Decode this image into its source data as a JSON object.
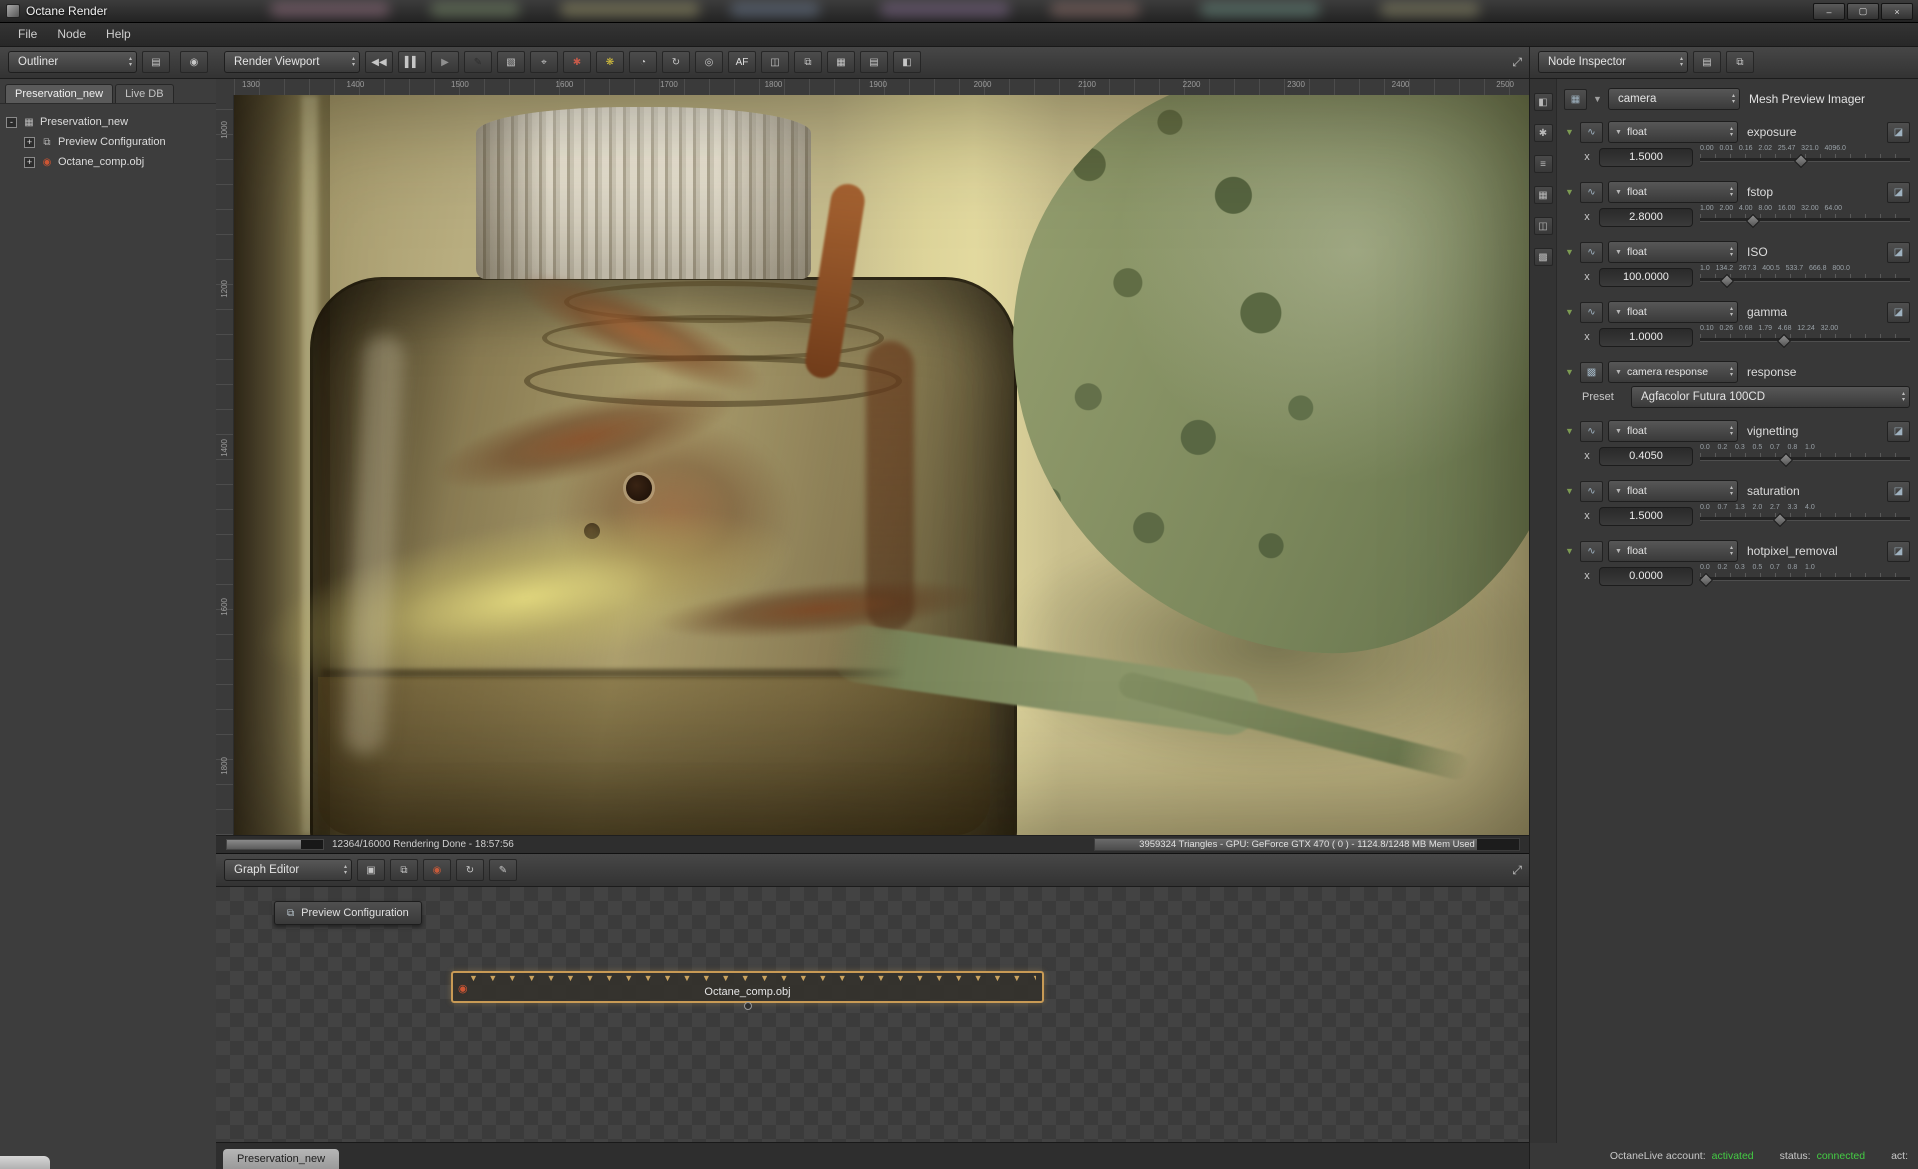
{
  "ui": {
    "dd_arrow": "▼",
    "up": "▴",
    "down": "▾",
    "tri": "▼",
    "expand": "⤢",
    "curve": "∿",
    "ramp": "◪",
    "pic": "▦",
    "resp": "▩"
  },
  "window": {
    "title": "Octane Render",
    "minimize": "–",
    "maximize": "▢",
    "close": "×"
  },
  "menu": {
    "file": "File",
    "node": "Node",
    "help": "Help"
  },
  "outliner": {
    "title": "Outliner",
    "icons": [
      {
        "g": "▤"
      },
      {
        "g": "◉"
      }
    ],
    "tabs": {
      "active": "Preservation_new",
      "other": "Live DB"
    },
    "tree": [
      {
        "toggle": "-",
        "icon": "▦",
        "label": "Preservation_new"
      },
      {
        "toggle": "+",
        "icon": "⧉",
        "label": "Preview Configuration"
      },
      {
        "toggle": "+",
        "icon": "◉",
        "label": "Octane_comp.obj"
      }
    ]
  },
  "viewport": {
    "title": "Render Viewport",
    "toolbar": [
      {
        "g": "◀◀",
        "c": "#c6c6c6"
      },
      {
        "g": "▌▌",
        "c": "#c6c6c6"
      },
      {
        "g": "▶",
        "c": "#8f8f8f"
      },
      {
        "g": "✎",
        "c": "#2e2e2e"
      },
      {
        "g": "▧",
        "c": "#c6c6c6"
      },
      {
        "g": "⌖",
        "c": "#c6c6c6"
      },
      {
        "g": "✱",
        "c": "#c65a4a"
      },
      {
        "g": "❋",
        "c": "#d9c33c"
      },
      {
        "g": "◔",
        "c": "#c6c6c6"
      },
      {
        "g": "↻",
        "c": "#c6c6c6"
      },
      {
        "g": "◎",
        "c": "#c6c6c6"
      },
      {
        "g": "AF",
        "c": "#e0e0e0"
      },
      {
        "g": "◫",
        "c": "#c6c6c6"
      },
      {
        "g": "⧉",
        "c": "#c6c6c6"
      },
      {
        "g": "▦",
        "c": "#c6c6c6"
      },
      {
        "g": "▤",
        "c": "#c6c6c6"
      },
      {
        "g": "◧",
        "c": "#c6c6c6"
      }
    ],
    "ruler_top": [
      "1300",
      "1400",
      "1500",
      "1600",
      "1700",
      "1800",
      "1900",
      "2000",
      "2100",
      "2200",
      "2300",
      "2400",
      "2500"
    ],
    "ruler_left": [
      "1000",
      "1200",
      "1400",
      "1600",
      "1800"
    ],
    "status": {
      "progress_pct": "77%",
      "progress_text": "12364/16000 Rendering Done - 18:57:56",
      "mem_pct": "90%",
      "gpu_text": "3959324 Triangles - GPU: GeForce GTX 470 ( 0 ) - 1124.8/1248 MB Mem Used"
    }
  },
  "graph": {
    "title": "Graph Editor",
    "toolbar": [
      {
        "g": "▣",
        "c": "#c6c6c6"
      },
      {
        "g": "⧉",
        "c": "#c6c6c6"
      },
      {
        "g": "◉",
        "c": "#c65a3a"
      },
      {
        "g": "↻",
        "c": "#c6c6c6"
      },
      {
        "g": "✎",
        "c": "#c6c6c6"
      }
    ],
    "preview_node": {
      "icon": "⧉",
      "label": "Preview Configuration"
    },
    "obj_node": {
      "icon": "◉",
      "label": "Octane_comp.obj",
      "pins": "▼▼▼▼▼▼▼▼▼▼▼▼▼▼▼▼▼▼▼▼▼▼▼▼▼▼▼▼▼▼",
      "outline": "#c89a55"
    },
    "tab": "Preservation_new"
  },
  "inspector": {
    "title": "Node Inspector",
    "icons": [
      {
        "g": "▤"
      },
      {
        "g": "⧉"
      }
    ],
    "strip": [
      {
        "g": "◧"
      },
      {
        "g": "✱"
      },
      {
        "g": "≡"
      },
      {
        "g": "▦"
      },
      {
        "g": "◫"
      },
      {
        "g": "▩"
      }
    ],
    "root": {
      "type": "camera",
      "label": "Mesh Preview Imager"
    },
    "axis": "x",
    "params": [
      {
        "type": "float",
        "name": "exposure",
        "value": "1.5000",
        "ticks": "0.00   0.01   0.16   2.02   25.47   321.0   4096.0",
        "pos": "48%"
      },
      {
        "type": "float",
        "name": "fstop",
        "value": "2.8000",
        "ticks": "1.00   2.00   4.00   8.00   16.00   32.00   64.00",
        "pos": "25%"
      },
      {
        "type": "float",
        "name": "ISO",
        "value": "100.0000",
        "ticks": "1.0   134.2   267.3   400.5   533.7   666.8   800.0",
        "pos": "13%"
      },
      {
        "type": "float",
        "name": "gamma",
        "value": "1.0000",
        "ticks": "0.10   0.26   0.68   1.79   4.68   12.24   32.00",
        "pos": "40%"
      },
      {
        "type": "camera response",
        "name": "response",
        "preset_label": "Preset",
        "preset_value": "Agfacolor Futura 100CD"
      },
      {
        "type": "float",
        "name": "vignetting",
        "value": "0.4050",
        "ticks": "0.0    0.2    0.3    0.5    0.7    0.8    1.0",
        "pos": "41%"
      },
      {
        "type": "float",
        "name": "saturation",
        "value": "1.5000",
        "ticks": "0.0    0.7    1.3    2.0    2.7    3.3    4.0",
        "pos": "38%"
      },
      {
        "type": "float",
        "name": "hotpixel_removal",
        "value": "0.0000",
        "ticks": "0.0    0.2    0.3    0.5    0.7    0.8    1.0",
        "pos": "3%"
      }
    ]
  },
  "statusbar": {
    "account_label": "OctaneLive account:",
    "account_value": "activated",
    "status_label": "status:",
    "status_value": "connected",
    "act_label": "act:",
    "green": "#44cc44"
  }
}
